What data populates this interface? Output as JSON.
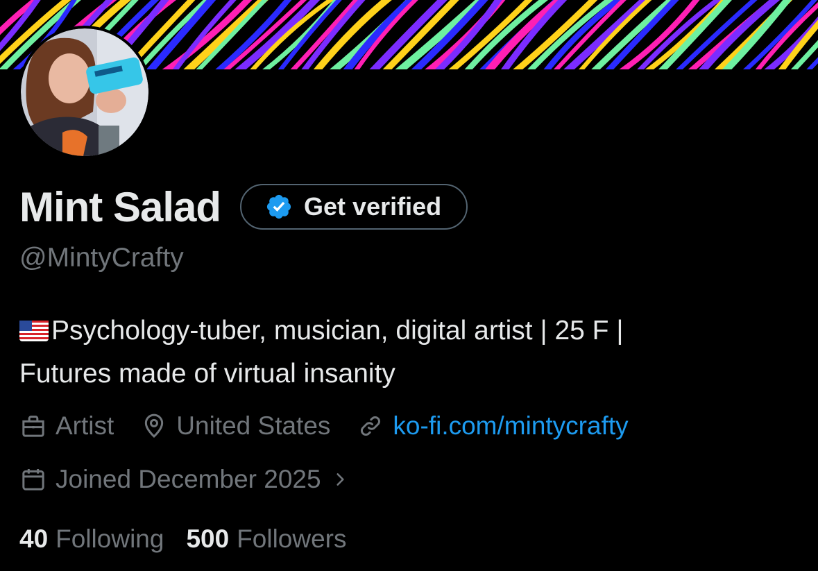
{
  "profile": {
    "display_name": "Mint Salad",
    "handle": "@MintyCrafty",
    "verify_label": "Get verified",
    "bio_flag_icon": "us-flag-emoji",
    "bio_line1": "Psychology-tuber, musician, digital artist | 25 F |",
    "bio_line2": "Futures made of virtual insanity",
    "profession": "Artist",
    "location": "United States",
    "website": "ko-fi.com/mintycrafty",
    "joined": "Joined December 2025",
    "following_count": "40",
    "following_label": "Following",
    "followers_count": "500",
    "followers_label": "Followers"
  },
  "icons": {
    "verify": "verified-badge-icon",
    "profession": "briefcase-icon",
    "location": "location-pin-icon",
    "website": "link-icon",
    "joined": "calendar-icon",
    "joined_more": "chevron-right-icon"
  },
  "colors": {
    "background": "#000000",
    "text_primary": "#e7e9ea",
    "text_secondary": "#71767b",
    "link": "#1d9bf0",
    "verified_badge": "#1d9bf0",
    "banner_palette": [
      "#ff1fb4",
      "#7b2cff",
      "#ffd21a",
      "#6ef0a0",
      "#2a2aff"
    ]
  }
}
